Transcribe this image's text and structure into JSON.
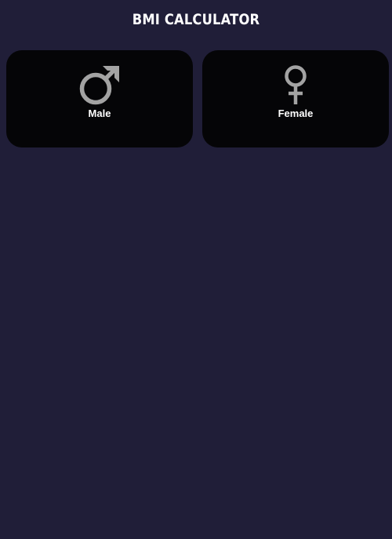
{
  "app": {
    "title": "BMI CALCULATOR"
  },
  "gender_options": [
    {
      "label": "Male",
      "icon": "male-symbol-icon"
    },
    {
      "label": "Female",
      "icon": "female-symbol-icon"
    }
  ],
  "colors": {
    "background": "#201e38",
    "card": "#050507",
    "icon": "#a3a3a3",
    "text": "#ffffff"
  }
}
